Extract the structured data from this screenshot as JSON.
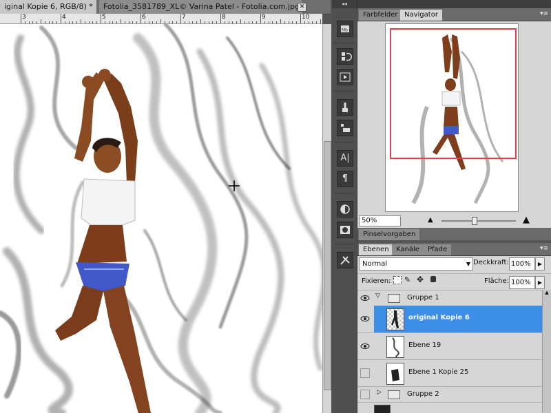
{
  "document_tabs": [
    {
      "label": "iginal Kopie 6, RGB/8) *",
      "active": true
    },
    {
      "label": "Fotolia_3581789_XL© Varina Patel - Fotolia.com.jpg",
      "active": false
    }
  ],
  "ruler_numbers": [
    "3",
    "4",
    "5",
    "6",
    "7",
    "8",
    "9",
    "10"
  ],
  "top_arrows": "◂◂",
  "navigator_panel": {
    "tabs": [
      "Farbfelder",
      "Navigator"
    ],
    "active_tab": "Navigator",
    "zoom": "50%"
  },
  "brush_panel": {
    "title": "Pinselvorgaben"
  },
  "layers_panel": {
    "tabs": [
      "Ebenen",
      "Kanäle",
      "Pfade"
    ],
    "active_tab": "Ebenen",
    "blend_mode": "Normal",
    "opacity_label": "Deckkraft:",
    "opacity_value": "100%",
    "lock_label": "Fixieren:",
    "fill_label": "Fläche:",
    "fill_value": "100%",
    "layers": [
      {
        "name": "Gruppe 1",
        "type": "group",
        "expanded": true,
        "visible": true
      },
      {
        "name": "original Kopie 6",
        "type": "layer",
        "selected": true,
        "visible": true
      },
      {
        "name": "Ebene 19",
        "type": "layer",
        "selected": false,
        "visible": true
      },
      {
        "name": "Ebene 1 Kopie 25",
        "type": "layer",
        "selected": false,
        "visible": false
      },
      {
        "name": "Gruppe 2",
        "type": "group",
        "expanded": false,
        "visible": false
      }
    ]
  },
  "colors": {
    "selection": "#3d8ee8",
    "view_box": "#e0404a",
    "panel_bg": "#d6d6d6"
  }
}
